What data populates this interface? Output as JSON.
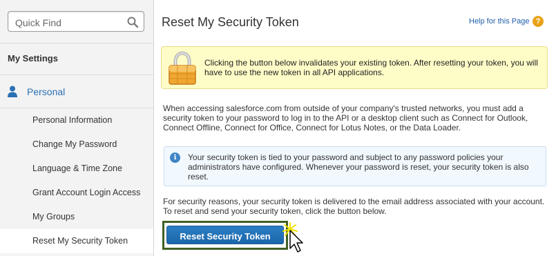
{
  "sidebar": {
    "search": {
      "placeholder": "Quick Find",
      "value": ""
    },
    "section_title": "My Settings",
    "personal_label": "Personal",
    "items": [
      {
        "label": "Personal Information"
      },
      {
        "label": "Change My Password"
      },
      {
        "label": "Language & Time Zone"
      },
      {
        "label": "Grant Account Login Access"
      },
      {
        "label": "My Groups"
      },
      {
        "label": "Reset My Security Token",
        "active": true
      }
    ]
  },
  "main": {
    "title": "Reset My Security Token",
    "help_link": "Help for this Page",
    "help_icon": "?",
    "warning_text": "Clicking the button below invalidates your existing token. After resetting your token, you will have to use the new token in all API applications.",
    "paragraph1": "When accessing salesforce.com from outside of your company's trusted networks, you must add a security token to your password to log in to the API or a desktop client such as Connect for Outlook, Connect Offline, Connect for Office, Connect for Lotus Notes, or the Data Loader.",
    "info_icon": "i",
    "info_text": "Your security token is tied to your password and subject to any password policies your administrators have configured. Whenever your password is reset, your security token is also reset.",
    "paragraph2": "For security reasons, your security token is delivered to the email address associated with your account. To reset and send your security token, click the button below.",
    "button_label": "Reset Security Token"
  },
  "colors": {
    "accent_link": "#2b6fb5",
    "button": "#1b66ab",
    "warning_bg": "#fffdc7",
    "info_bg": "#f1f8fe",
    "highlight_border": "#3f5f23"
  }
}
